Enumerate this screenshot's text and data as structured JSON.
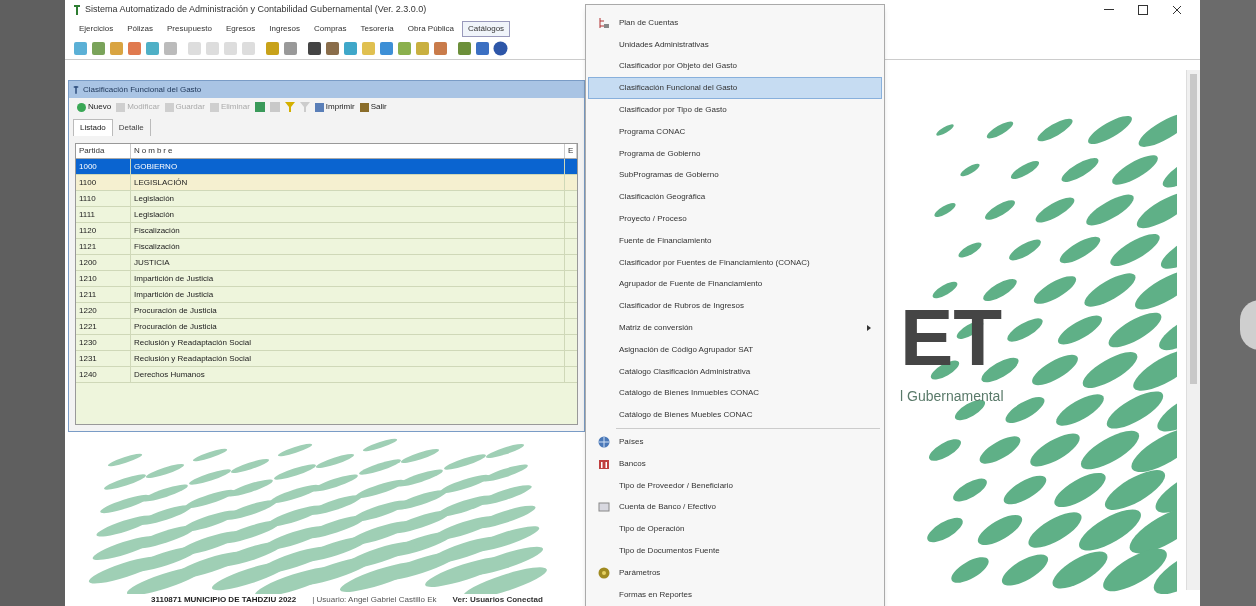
{
  "window": {
    "title": "Sistema Automatizado de Administración y Contabilidad Gubernamental  (Ver. 2.3.0.0)"
  },
  "menu_bar": [
    {
      "label": "Ejercicios",
      "selected": false
    },
    {
      "label": "Pólizas",
      "selected": false
    },
    {
      "label": "Presupuesto",
      "selected": false
    },
    {
      "label": "Egresos",
      "selected": false
    },
    {
      "label": "Ingresos",
      "selected": false
    },
    {
      "label": "Compras",
      "selected": false
    },
    {
      "label": "Tesorería",
      "selected": false
    },
    {
      "label": "Obra Pública",
      "selected": false
    },
    {
      "label": "Catálogos",
      "selected": true
    }
  ],
  "child_window": {
    "title": "Clasificación Funcional del Gasto",
    "toolbar": [
      {
        "label": "Nuevo",
        "disabled": false
      },
      {
        "label": "Modificar",
        "disabled": true
      },
      {
        "label": "Guardar",
        "disabled": true
      },
      {
        "label": "Eliminar",
        "disabled": true
      },
      {
        "label": "Imprimir",
        "disabled": false
      },
      {
        "label": "Salir",
        "disabled": false
      }
    ],
    "tabs": [
      {
        "label": "Listado",
        "selected": true
      },
      {
        "label": "Detalle",
        "selected": false
      }
    ],
    "table": {
      "columns": [
        "Partida",
        "Nombre",
        "E"
      ],
      "rows": [
        {
          "partida": "1000",
          "nombre": "GOBIERNO",
          "selected": true
        },
        {
          "partida": "1100",
          "nombre": "LEGISLACIÓN",
          "selected": false
        },
        {
          "partida": "1110",
          "nombre": "Legislación",
          "selected": false
        },
        {
          "partida": "1111",
          "nombre": "Legislación",
          "selected": false
        },
        {
          "partida": "1120",
          "nombre": "Fiscalización",
          "selected": false
        },
        {
          "partida": "1121",
          "nombre": "Fiscalización",
          "selected": false
        },
        {
          "partida": "1200",
          "nombre": "JUSTICIA",
          "selected": false
        },
        {
          "partida": "1210",
          "nombre": "Impartición de Justicia",
          "selected": false
        },
        {
          "partida": "1211",
          "nombre": "Impartición de Justicia",
          "selected": false
        },
        {
          "partida": "1220",
          "nombre": "Procuración de Justicia",
          "selected": false
        },
        {
          "partida": "1221",
          "nombre": "Procuración de Justicia",
          "selected": false
        },
        {
          "partida": "1230",
          "nombre": "Reclusión y Readaptación Social",
          "selected": false
        },
        {
          "partida": "1231",
          "nombre": "Reclusión y Readaptación Social",
          "selected": false
        },
        {
          "partida": "1240",
          "nombre": "Derechos Humanos",
          "selected": false
        }
      ]
    }
  },
  "logo": {
    "letters": "ET",
    "subtitle": "l Gubernamental"
  },
  "status_bar": [
    "3110871 MUNICIPIO DE TAHDZIU  2022",
    "| Usuario: Angel Gabriel Castillo Ek",
    "Ver: Usuarios Conectad"
  ],
  "dropdown_menu": [
    {
      "label": "Plan de Cuentas",
      "selected": false,
      "kind": "tree"
    },
    {
      "label": "Unidades Administrativas",
      "selected": false
    },
    {
      "label": "Clasificador por Objeto del Gasto",
      "selected": false
    },
    {
      "label": "Clasificación Funcional del Gasto",
      "selected": true
    },
    {
      "label": "Clasificador por Tipo de Gasto",
      "selected": false
    },
    {
      "label": "Programa CONAC",
      "selected": false
    },
    {
      "label": "Programa de Gobierno",
      "selected": false
    },
    {
      "label": "SubProgramas de Gobierno",
      "selected": false
    },
    {
      "label": "Clasificación Geográfica",
      "selected": false
    },
    {
      "label": "Proyecto / Proceso",
      "selected": false
    },
    {
      "label": "Fuente de Financiamiento",
      "selected": false
    },
    {
      "label": "Clasificador por Fuentes de Financiamiento (CONAC)",
      "selected": false
    },
    {
      "label": "Agrupador de Fuente de Financiamiento",
      "selected": false
    },
    {
      "label": "Clasificador de Rubros de Ingresos",
      "selected": false
    },
    {
      "label": "Matriz de conversión",
      "selected": false,
      "submenu": true
    },
    {
      "label": "Asignación de Código Agrupador SAT",
      "selected": false
    },
    {
      "label": "Catálogo Clasificación Administrativa",
      "selected": false
    },
    {
      "label": "Catálogo de Bienes Inmuebles CONAC",
      "selected": false
    },
    {
      "label": "Catálogo de Bienes Muebles CONAC",
      "selected": false,
      "separator_after": true
    },
    {
      "label": "Países",
      "selected": false,
      "kind": "globe"
    },
    {
      "label": "Bancos",
      "selected": false,
      "kind": "bank"
    },
    {
      "label": "Tipo de Proveedor / Beneficiario",
      "selected": false
    },
    {
      "label": "Cuenta de Banco / Efectivo",
      "selected": false,
      "kind": "card"
    },
    {
      "label": "Tipo de Operación",
      "selected": false
    },
    {
      "label": "Tipo de Documentos Fuente",
      "selected": false
    },
    {
      "label": "Parámetros",
      "selected": false,
      "kind": "gear"
    },
    {
      "label": "Formas en Reportes",
      "selected": false
    }
  ]
}
